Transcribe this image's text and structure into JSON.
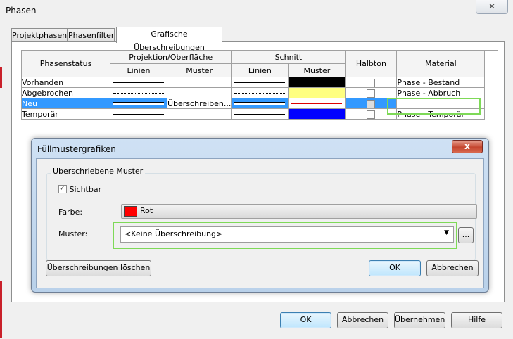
{
  "window": {
    "title": "Phasen",
    "close_glyph": "✕"
  },
  "tabs": [
    {
      "label": "Projektphasen",
      "active": false
    },
    {
      "label": "Phasenfilter",
      "active": false
    },
    {
      "label": "Grafische Überschreibungen",
      "active": true
    }
  ],
  "grid": {
    "headers": {
      "status": "Phasenstatus",
      "projection": "Projektion/Oberfläche",
      "cut": "Schnitt",
      "halftone": "Halbton",
      "material": "Material",
      "lines": "Linien",
      "pattern": "Muster"
    },
    "rows": [
      {
        "status": "Vorhanden",
        "proj_line": "solid",
        "proj_pattern": "",
        "cut_line": "solid",
        "cut_pattern_color": "#000000",
        "halftone": false,
        "material": "Phase - Bestand",
        "selected": false
      },
      {
        "status": "Abgebrochen",
        "proj_line": "dashed",
        "proj_pattern": "",
        "cut_line": "dashed",
        "cut_pattern_color": "#ffff80",
        "halftone": false,
        "material": "Phase - Abbruch",
        "selected": false
      },
      {
        "status": "Neu",
        "proj_line": "solid",
        "proj_pattern": "Überschreiben...",
        "cut_line": "solid",
        "cut_pattern_color": "#ffffff",
        "halftone": false,
        "material": "",
        "selected": true
      },
      {
        "status": "Temporär",
        "proj_line": "solid",
        "proj_pattern": "",
        "cut_line": "solid",
        "cut_pattern_color": "#0000ff",
        "halftone": false,
        "material": "Phase - Temporär",
        "selected": false
      }
    ]
  },
  "dialog": {
    "title": "Füllmustergrafiken",
    "close_glyph": "x",
    "group_label": "Überschriebene Muster",
    "visible_label": "Sichtbar",
    "visible_checked": true,
    "color_label": "Farbe:",
    "color_value": "Rot",
    "color_hex": "#ff0000",
    "pattern_label": "Muster:",
    "pattern_value": "<Keine Überschreibung>",
    "browse_label": "...",
    "clear_button": "Überschreibungen löschen",
    "ok_button": "OK",
    "cancel_button": "Abbrechen"
  },
  "footer": {
    "ok": "OK",
    "cancel": "Abbrechen",
    "apply": "Übernehmen",
    "help": "Hilfe"
  },
  "accent_colors": {
    "selection": "#3399ff",
    "highlight": "#7ed957"
  }
}
